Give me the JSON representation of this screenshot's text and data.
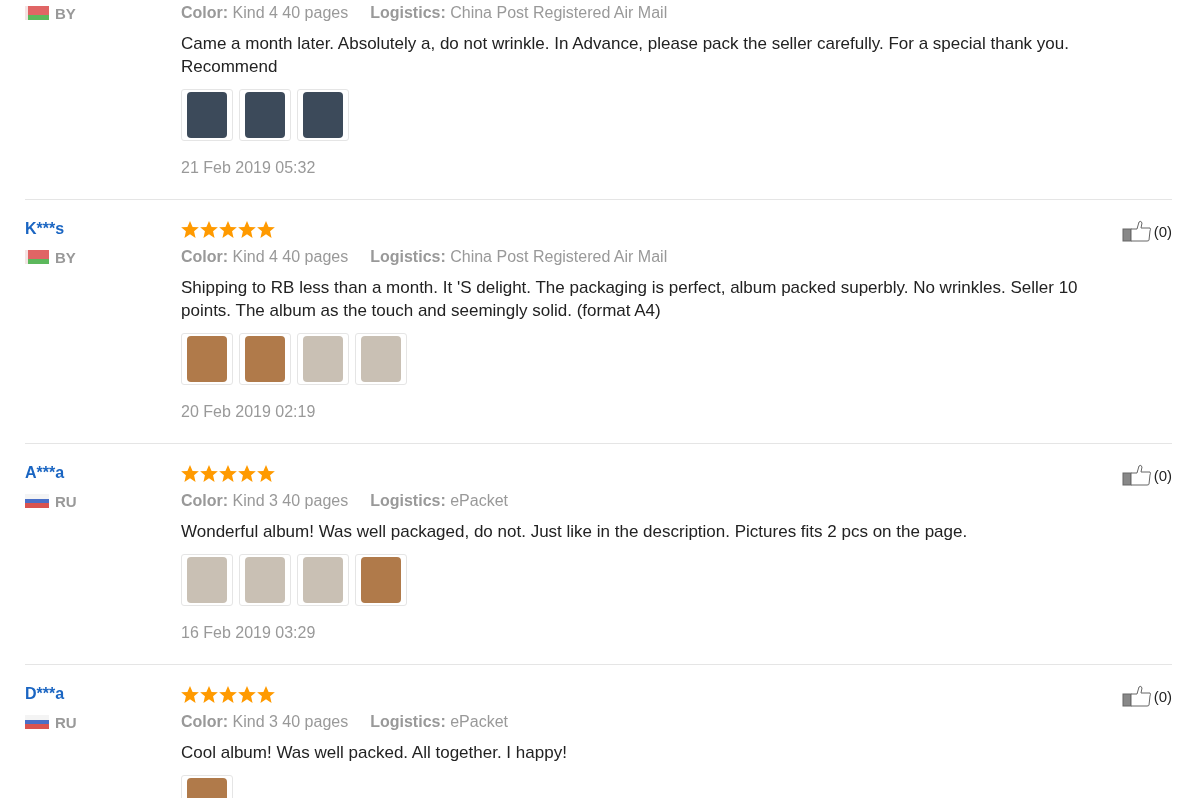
{
  "reviews": [
    {
      "kind": "belarus",
      "country": "BY",
      "color_label": "Color:",
      "variant": "Kind 4 40 pages",
      "logistics_label": "Logistics:",
      "logistics": "China Post Registered Air Mail",
      "text": "Came a month later. Absolutely a, do not wrinkle. In Advance, please pack the seller carefully. For a special thank you. Recommend",
      "photos": [
        {
          "kind": "dark"
        },
        {
          "kind": "dark"
        },
        {
          "kind": "dark"
        }
      ],
      "date": "21 Feb 2019 05:32"
    },
    {
      "name": "K***s",
      "stars": 5,
      "likes": "(0)",
      "kind": "belarus",
      "country": "BY",
      "color_label": "Color:",
      "variant": "Kind 4 40 pages",
      "logistics_label": "Logistics:",
      "logistics": "China Post Registered Air Mail",
      "text": "Shipping to RB less than a month. It 'S delight. The packaging is perfect, album packed superbly. No wrinkles. Seller 10 points. The album as the touch and seemingly solid. (format A4)",
      "photos": [
        {
          "kind": "warm"
        },
        {
          "kind": "warm"
        },
        {
          "kind": "light"
        },
        {
          "kind": "light"
        }
      ],
      "date": "20 Feb 2019 02:19"
    },
    {
      "name": "A***a",
      "stars": 5,
      "likes": "(0)",
      "kind": "russia",
      "country": "RU",
      "color_label": "Color:",
      "variant": "Kind 3 40 pages",
      "logistics_label": "Logistics:",
      "logistics": "ePacket",
      "text": "Wonderful album! Was well packaged, do not. Just like in the description. Pictures fits 2 pcs on the page.",
      "photos": [
        {
          "kind": "light"
        },
        {
          "kind": "light"
        },
        {
          "kind": "light"
        },
        {
          "kind": "warm"
        }
      ],
      "date": "16 Feb 2019 03:29"
    },
    {
      "name": "D***a",
      "stars": 5,
      "likes": "(0)",
      "kind": "russia",
      "country": "RU",
      "color_label": "Color:",
      "variant": "Kind 3 40 pages",
      "logistics_label": "Logistics:",
      "logistics": "ePacket",
      "text": "Cool album! Was well packed. All together. I happy!",
      "photos": [
        {
          "kind": "warm"
        }
      ]
    }
  ]
}
